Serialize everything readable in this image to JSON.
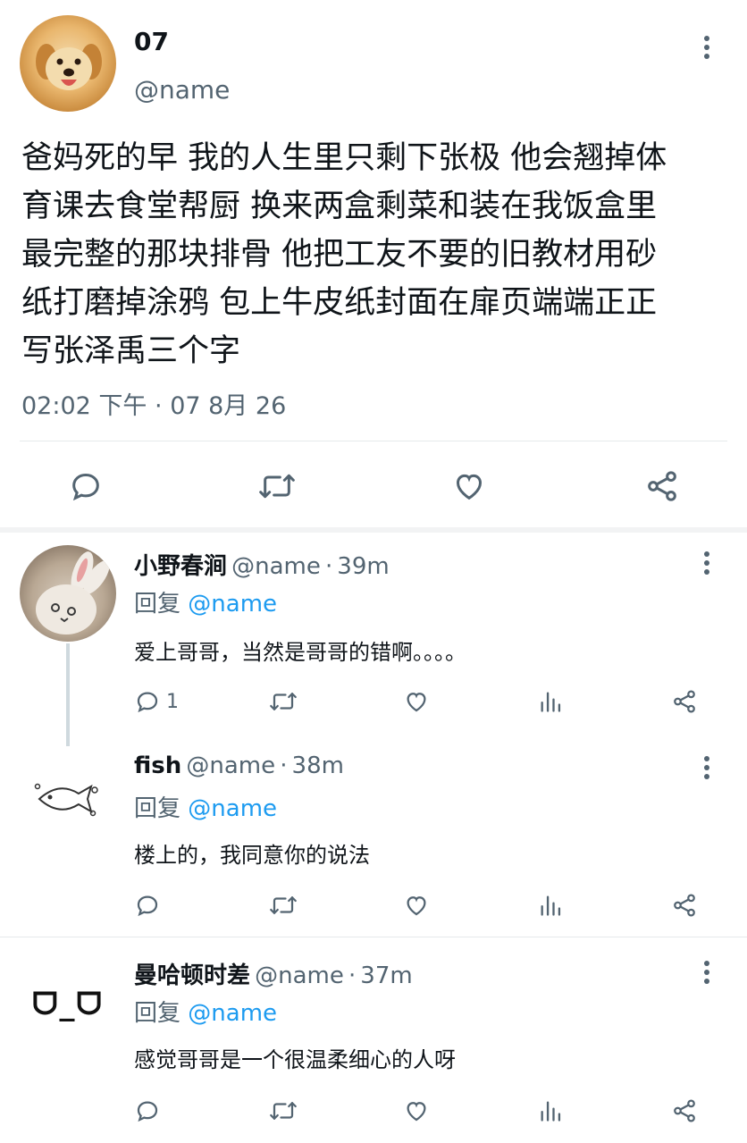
{
  "post": {
    "name": "07",
    "handle": "@name",
    "text_lines": [
      "爸妈死的早 我的人生里只剩下张极 他会翘掉体",
      "育课去食堂帮厨 换来两盒剩菜和装在我饭盒里",
      "最完整的那块排骨 他把工友不要的旧教材用砂",
      "纸打磨掉涂鸦 包上牛皮纸封面在扉页端端正正",
      "写张泽禹三个字"
    ],
    "time": "02:02 下午",
    "dot": "·",
    "date": "07 8月 26",
    "icons": {
      "more": "more-vertical-icon",
      "reply": "reply-icon",
      "retweet": "retweet-icon",
      "like": "heart-icon",
      "share": "share-icon"
    }
  },
  "replies": [
    {
      "name": "小野春涧",
      "handle": "@name",
      "dot": "·",
      "age": "39m",
      "reply_prefix": "回复",
      "reply_to": "@name",
      "text": "爱上哥哥，当然是哥哥的错啊。。。。",
      "reply_count": "1"
    },
    {
      "name": "fish",
      "handle": "@name",
      "dot": "·",
      "age": "38m",
      "reply_prefix": "回复",
      "reply_to": "@name",
      "text": "楼上的，我同意你的说法",
      "reply_count": ""
    },
    {
      "name": "曼哈顿时差",
      "handle": "@name",
      "dot": "·",
      "age": "37m",
      "reply_prefix": "回复",
      "reply_to": "@name",
      "text": "感觉哥哥是一个很温柔细心的人呀",
      "reply_count": "",
      "avatar_text": "ᗜ_ᗜ"
    }
  ],
  "colors": {
    "accent": "#1d9bf0",
    "muted": "#536471",
    "text": "#0f1419",
    "divider": "#e6e9eb"
  }
}
